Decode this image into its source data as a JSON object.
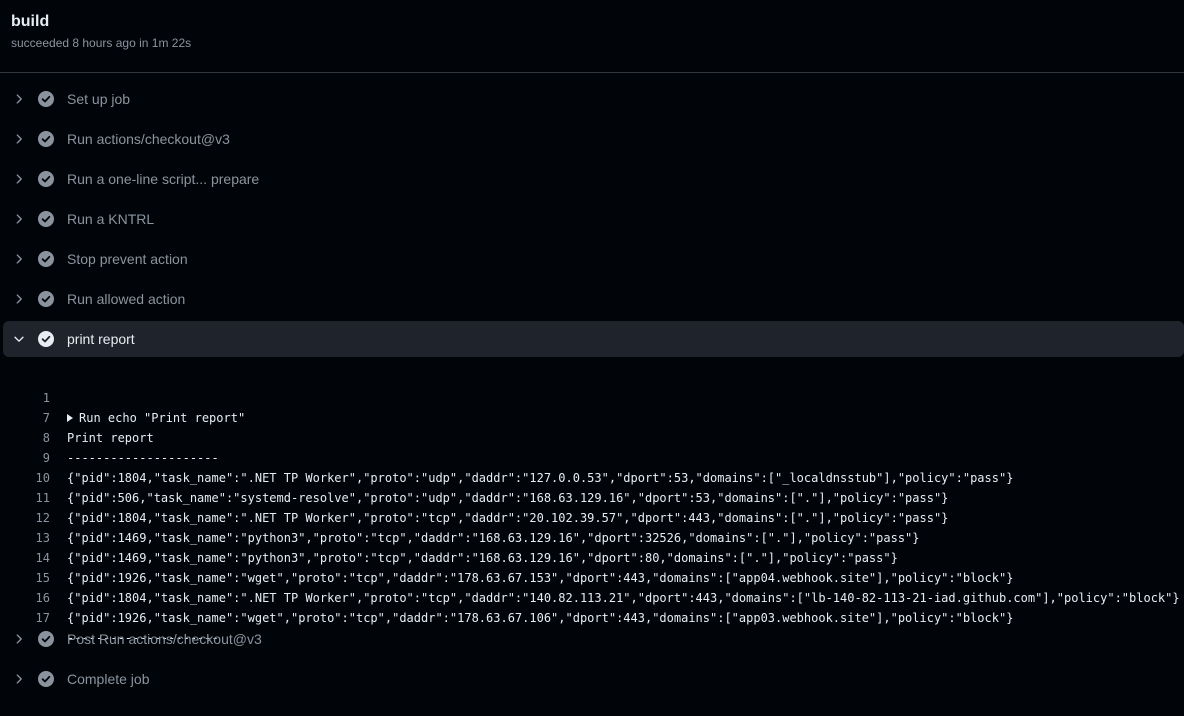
{
  "job": {
    "title": "build",
    "meta": "succeeded 8 hours ago in 1m 22s"
  },
  "steps": [
    {
      "label": "Set up job"
    },
    {
      "label": "Run actions/checkout@v3"
    },
    {
      "label": "Run a one-line script... prepare"
    },
    {
      "label": "Run a KNTRL"
    },
    {
      "label": "Stop prevent action"
    },
    {
      "label": "Run allowed action"
    },
    {
      "label": "print report"
    },
    {
      "label": "Post Run actions/checkout@v3"
    },
    {
      "label": "Complete job"
    }
  ],
  "log": [
    {
      "n": "1",
      "text": "Run echo \"Print report\""
    },
    {
      "n": "7",
      "text": "Print report"
    },
    {
      "n": "8",
      "text": "---------------------"
    },
    {
      "n": "9",
      "text": "{\"pid\":1804,\"task_name\":\".NET TP Worker\",\"proto\":\"udp\",\"daddr\":\"127.0.0.53\",\"dport\":53,\"domains\":[\"_localdnsstub\"],\"policy\":\"pass\"}"
    },
    {
      "n": "10",
      "text": "{\"pid\":506,\"task_name\":\"systemd-resolve\",\"proto\":\"udp\",\"daddr\":\"168.63.129.16\",\"dport\":53,\"domains\":[\".\"],\"policy\":\"pass\"}"
    },
    {
      "n": "11",
      "text": "{\"pid\":1804,\"task_name\":\".NET TP Worker\",\"proto\":\"tcp\",\"daddr\":\"20.102.39.57\",\"dport\":443,\"domains\":[\".\"],\"policy\":\"pass\"}"
    },
    {
      "n": "12",
      "text": "{\"pid\":1469,\"task_name\":\"python3\",\"proto\":\"tcp\",\"daddr\":\"168.63.129.16\",\"dport\":32526,\"domains\":[\".\"],\"policy\":\"pass\"}"
    },
    {
      "n": "13",
      "text": "{\"pid\":1469,\"task_name\":\"python3\",\"proto\":\"tcp\",\"daddr\":\"168.63.129.16\",\"dport\":80,\"domains\":[\".\"],\"policy\":\"pass\"}"
    },
    {
      "n": "14",
      "text": "{\"pid\":1926,\"task_name\":\"wget\",\"proto\":\"tcp\",\"daddr\":\"178.63.67.153\",\"dport\":443,\"domains\":[\"app04.webhook.site\"],\"policy\":\"block\"}"
    },
    {
      "n": "15",
      "text": "{\"pid\":1804,\"task_name\":\".NET TP Worker\",\"proto\":\"tcp\",\"daddr\":\"140.82.113.21\",\"dport\":443,\"domains\":[\"lb-140-82-113-21-iad.github.com\"],\"policy\":\"block\"}"
    },
    {
      "n": "16",
      "text": "{\"pid\":1926,\"task_name\":\"wget\",\"proto\":\"tcp\",\"daddr\":\"178.63.67.106\",\"dport\":443,\"domains\":[\"app03.webhook.site\"],\"policy\":\"block\"}"
    },
    {
      "n": "17",
      "text": "---------------------"
    }
  ],
  "colors": {
    "background": "#010409",
    "expanded_row": "#1f242c",
    "check_icon": "#8b949e"
  }
}
